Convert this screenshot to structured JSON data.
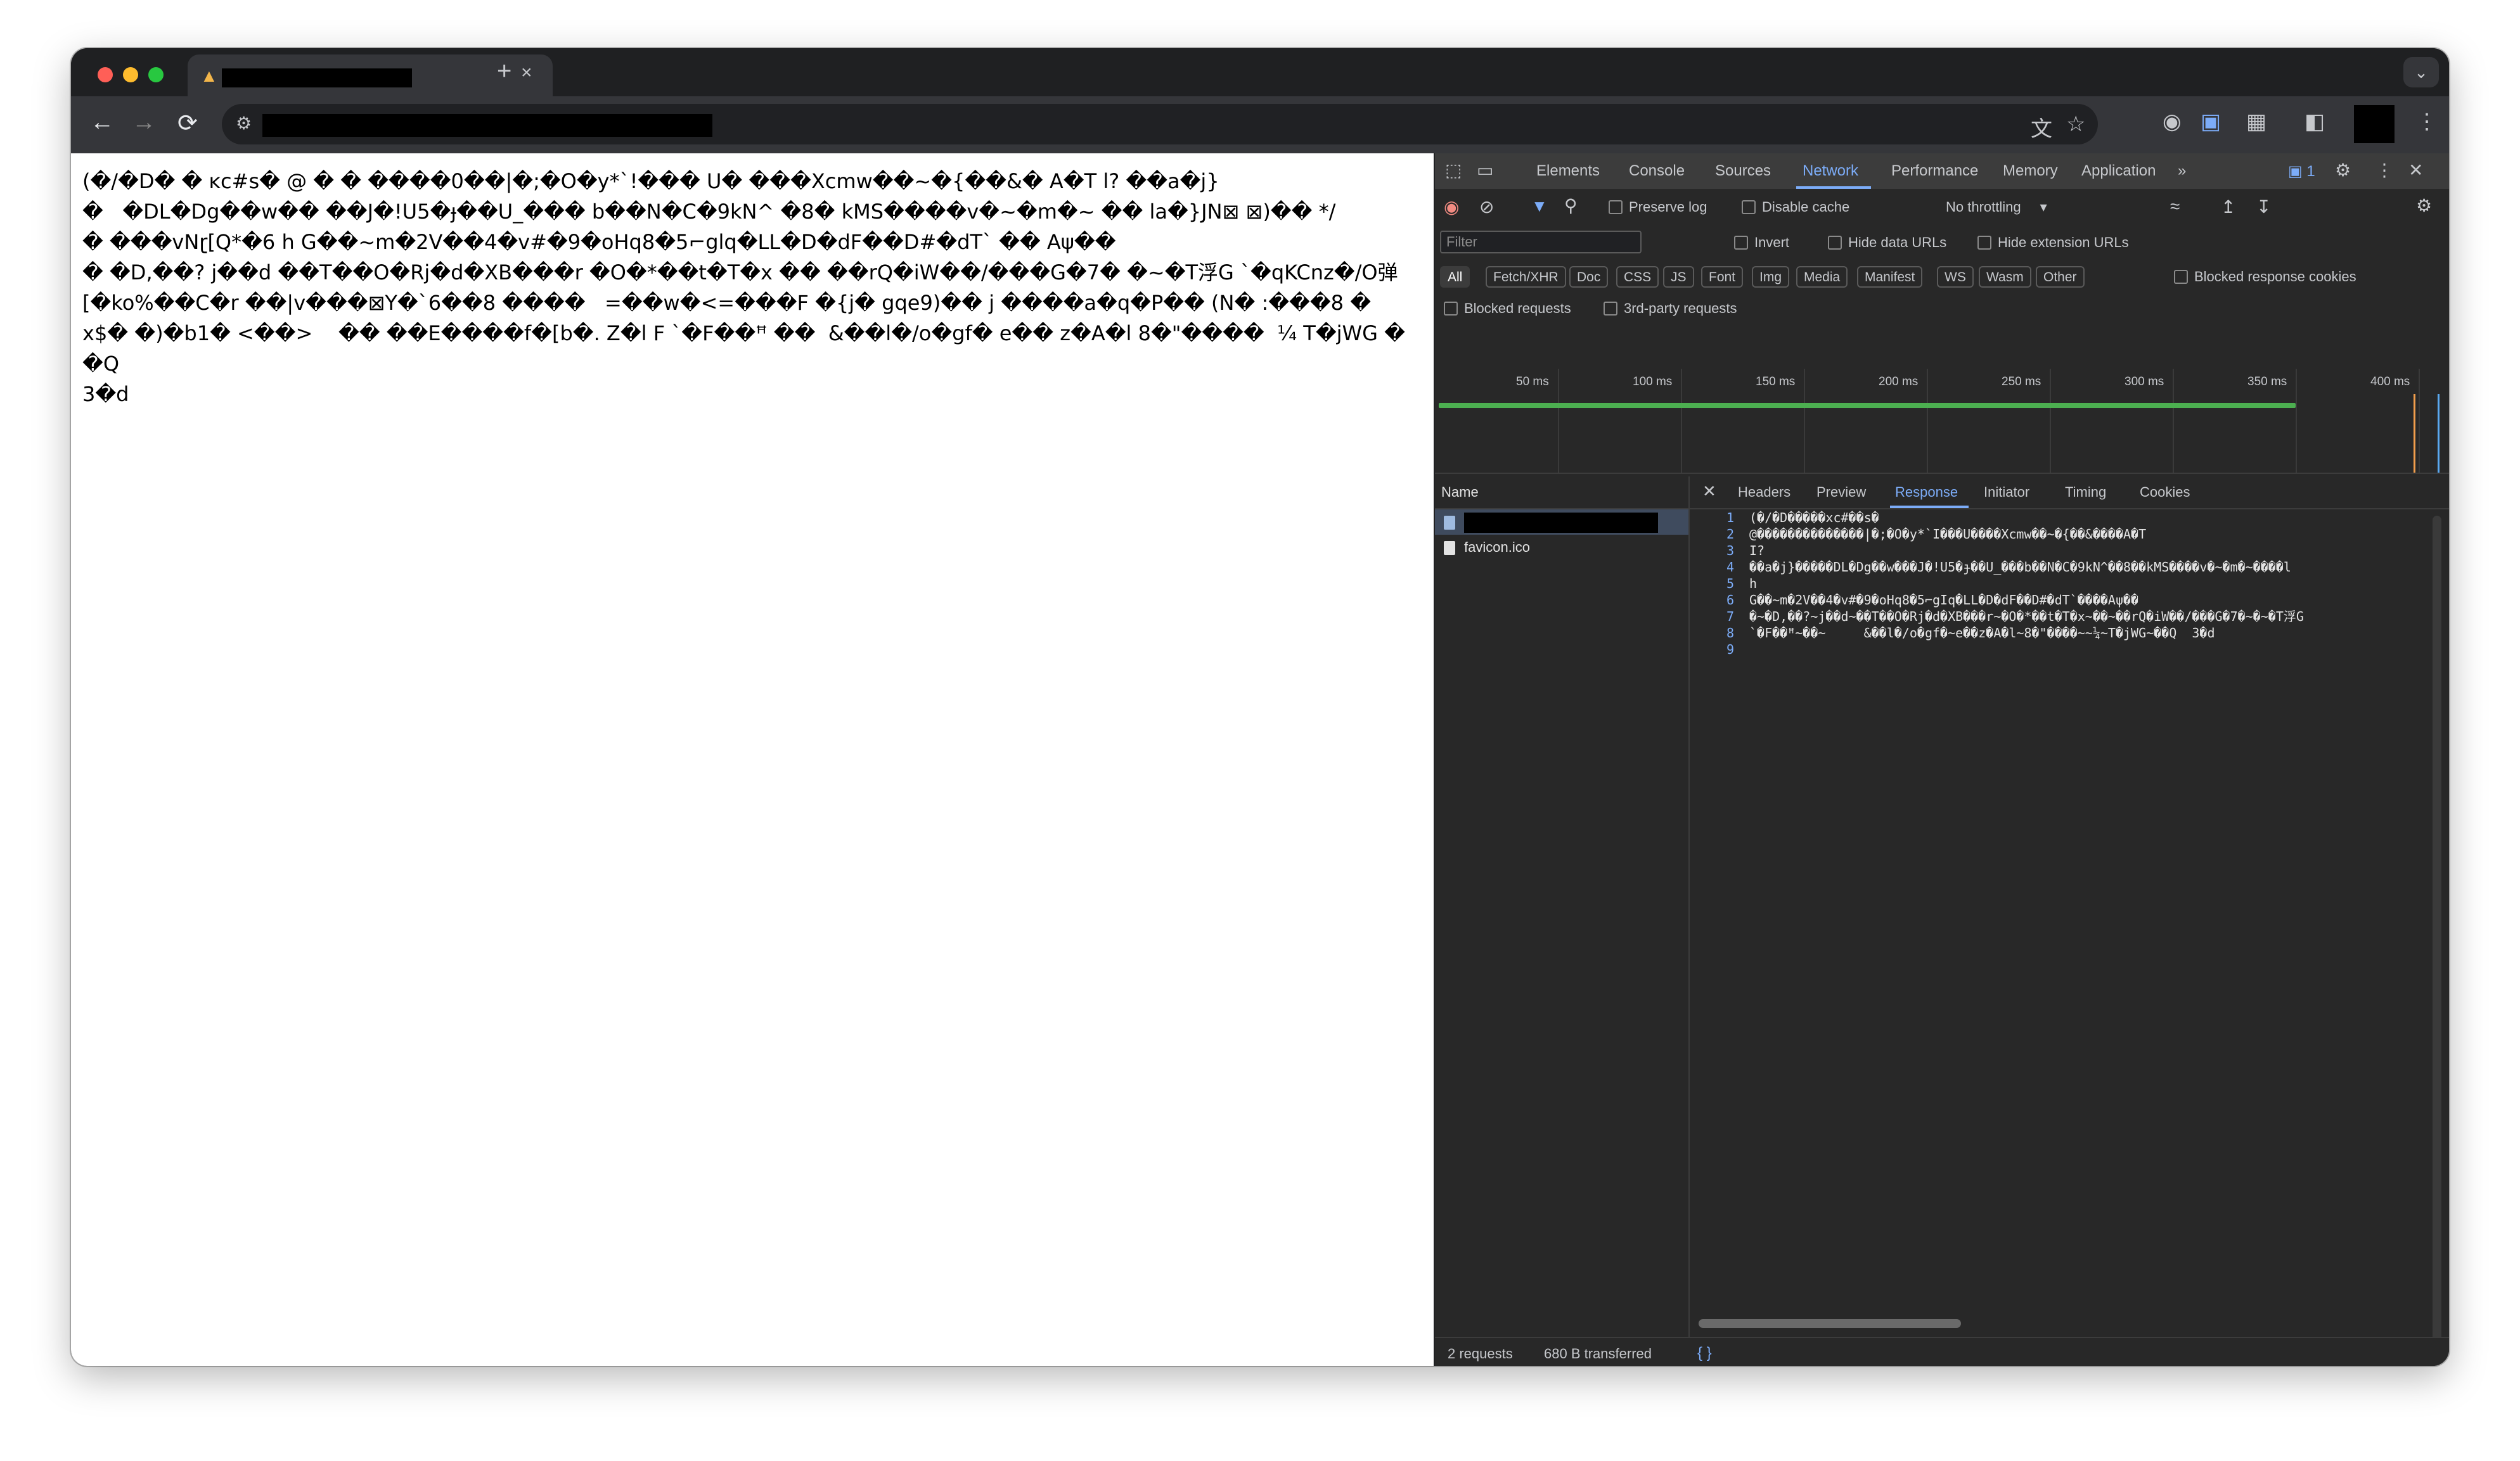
{
  "browser": {
    "tab": {
      "favicon": "fire-icon",
      "close": "×"
    },
    "new_tab": "+",
    "tab_search": "⌄",
    "nav": {
      "back": "←",
      "forward": "→",
      "reload": "⟳"
    },
    "site_info": "⚙"
  },
  "page": {
    "body_text": "(�/�D� � ĸc#s� @ � � ����0��|�;�O�y*`!��� U� ���Xcmw��~�{��&� A�T l? ��a�j}\n�   �DL�Dg��w�� ��J�!U5�ɟ��U_��� b��N�C�9kN^ �8� kMS����v�~�m�~ �� la�}JN⊠ ⊠)�� */\n� ���vNɽ[Q*�6 h G��~m�2V��4�v#�9�oHq8�5⌐glq�LL�D�dF��D#�dT` �� Aψ��\n� �D,��? j��d ��T��O�Rj�d�XB���r �O�*��t�T�x �� ��rQ�iW��/���G�7� �~�T浮G `�qKCnz�/O弹\n[�ko%��C�r ��|v���⊠Y�`6��8 ����   =��w�<=���F �{j� gqe9)�� j ����a�q�P�� (N� :���8 �\nx$� �)�b1� <��>    �� ��E����f�[b�. Z�l F `�F��ꟸ ��  &��l�/o�gf� e�� z�A�l 8�\"����  ¼ T�jWG ��Q\n3�d"
  },
  "devtools": {
    "tabs": [
      "Elements",
      "Console",
      "Sources",
      "Network",
      "Performance",
      "Memory",
      "Application"
    ],
    "active_tab": "Network",
    "issues_count": "1",
    "more_tabs": "»",
    "toolbar": {
      "preserve_log": "Preserve log",
      "disable_cache": "Disable cache",
      "throttling": "No throttling"
    },
    "filter": {
      "placeholder": "Filter",
      "invert": "Invert",
      "hide_data_urls": "Hide data URLs",
      "hide_extension_urls": "Hide extension URLs",
      "types": [
        "All",
        "Fetch/XHR",
        "Doc",
        "CSS",
        "JS",
        "Font",
        "Img",
        "Media",
        "Manifest",
        "WS",
        "Wasm",
        "Other"
      ],
      "blocked_response_cookies": "Blocked response cookies",
      "blocked_requests": "Blocked requests",
      "third_party": "3rd-party requests"
    },
    "timeline": {
      "ticks": [
        "50 ms",
        "100 ms",
        "150 ms",
        "200 ms",
        "250 ms",
        "300 ms",
        "350 ms",
        "400 ms"
      ]
    },
    "requests": {
      "header": "Name",
      "rows": [
        "",
        "favicon.ico"
      ]
    },
    "detail_tabs": [
      "Headers",
      "Preview",
      "Response",
      "Initiator",
      "Timing",
      "Cookies"
    ],
    "active_detail_tab": "Response",
    "response_lines": [
      "(�/�D�����xc#��s�",
      "@��������������|�;�O�y*`I���U����Xcmw��~�{��&����A�T",
      "I?",
      "��a�j}�����DL�Dg��w���J�!U5�ɟ��U_���b��N�C�9kN^��8��kMS����v�~�m�~����l",
      "h",
      "G��~m�2V��4�v#�9�oHq8�5⌐gIq�LL�D�dF��D#�dT`����Aψ��",
      "�~�D,��?~j��d~��T��O�Rj�d�XB���r~�O�*��t�T�x~��~��rQ�iW��/���G�7�~�~�T浮G",
      "`�F��ꟸ~��~     &��l�/o�gf�~e��z�A�l~8�\"����~~¼~T�jWG~��Q  3�d",
      ""
    ],
    "status": {
      "requests": "2 requests",
      "transferred": "680 B transferred",
      "format": "{ }"
    }
  }
}
